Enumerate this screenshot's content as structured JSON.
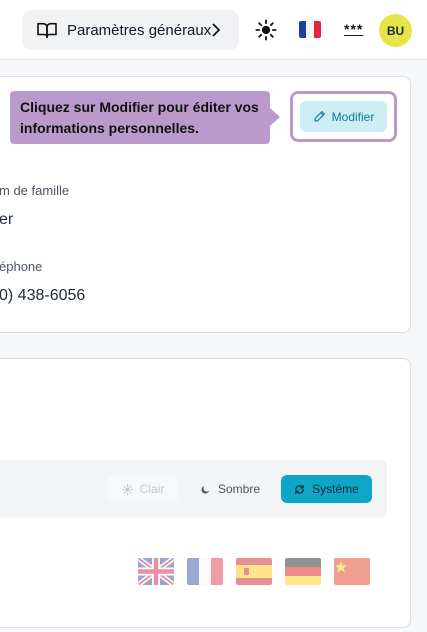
{
  "header": {
    "settings_label": "Paramètres généraux",
    "more_label": "***",
    "avatar_initials": "BU"
  },
  "profile": {
    "tooltip_text": "Cliquez sur Modifier pour éditer vos informations personnelles.",
    "edit_label": "Modifier",
    "fields": [
      {
        "label": "m de famille",
        "value": "er"
      },
      {
        "label": "éphone",
        "value": "0) 438-6056"
      }
    ]
  },
  "appearance": {
    "theme_options": [
      {
        "label": "Clair",
        "icon": "sun-icon"
      },
      {
        "label": "Sombre",
        "icon": "moon-icon"
      },
      {
        "label": "Système",
        "icon": "sync-icon"
      }
    ],
    "selected_theme": "Système",
    "languages": [
      {
        "icon": "flag-uk-icon"
      },
      {
        "icon": "flag-fr-icon"
      },
      {
        "icon": "flag-es-icon"
      },
      {
        "icon": "flag-de-icon"
      },
      {
        "icon": "flag-cn-icon"
      }
    ]
  },
  "colors": {
    "accent": "#0ea5c6",
    "tooltip": "#b99acb",
    "avatar": "#e3e548"
  }
}
